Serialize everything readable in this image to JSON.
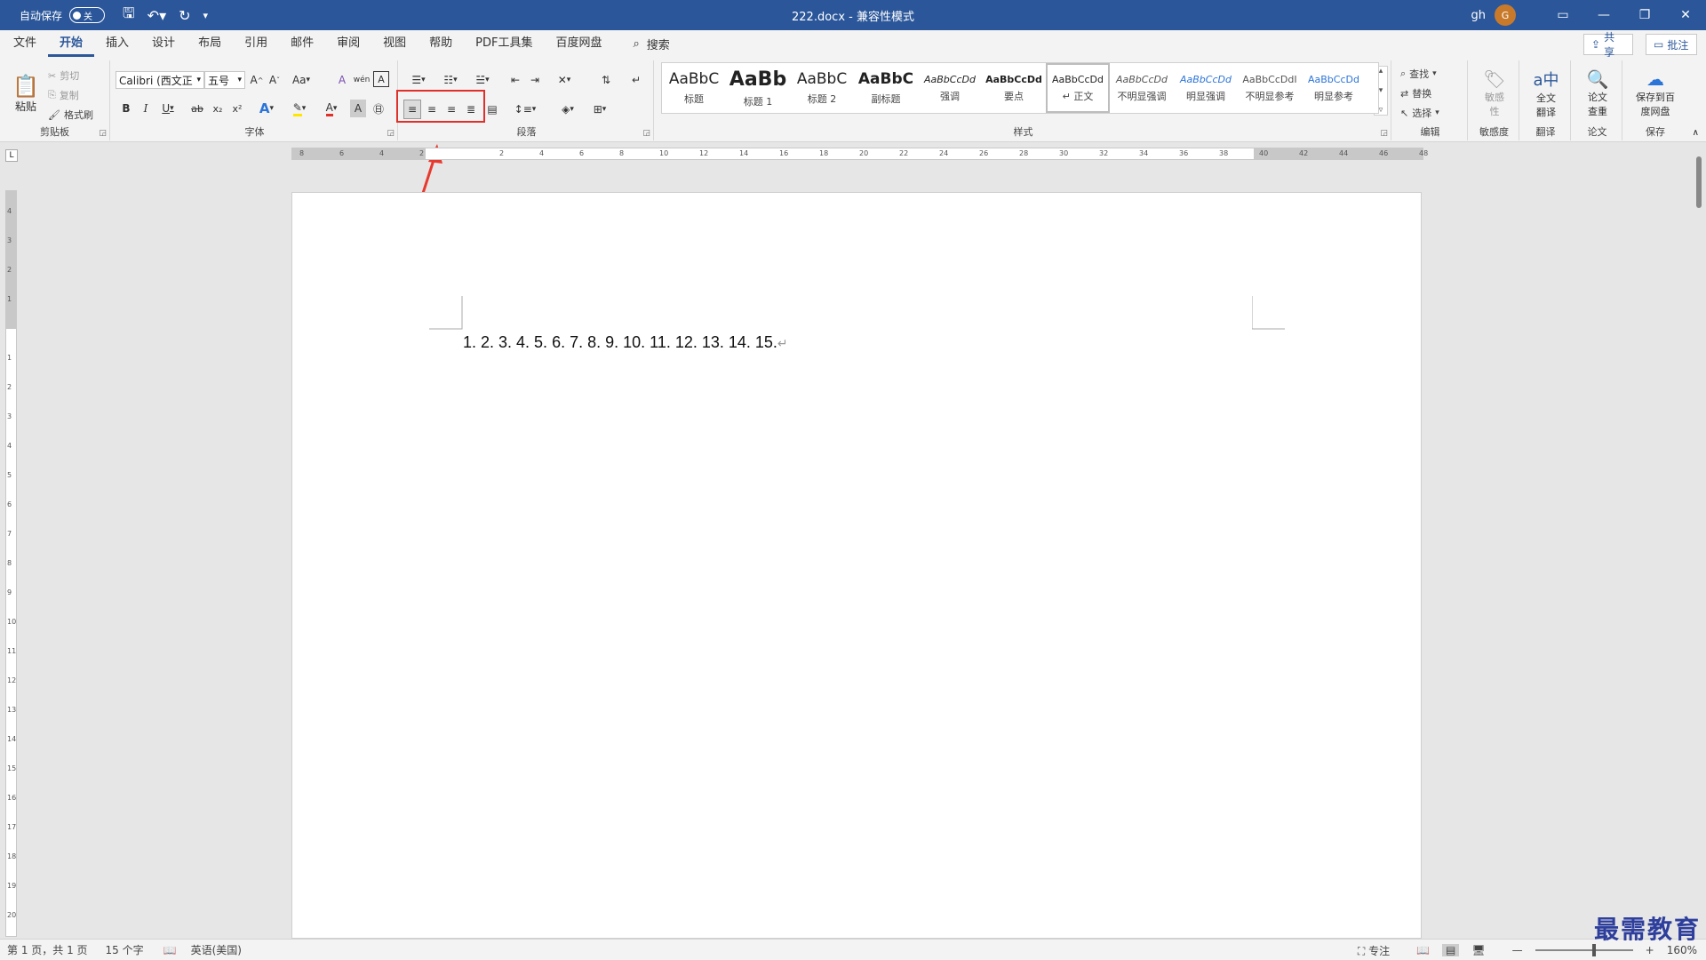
{
  "titlebar": {
    "autosave_label": "自动保存",
    "autosave_state": "关",
    "document_title": "222.docx  -  兼容性模式",
    "user_name": "gh",
    "user_initial": "G"
  },
  "menu": {
    "tabs": [
      "文件",
      "开始",
      "插入",
      "设计",
      "布局",
      "引用",
      "邮件",
      "审阅",
      "视图",
      "帮助",
      "PDF工具集",
      "百度网盘"
    ],
    "active": "开始",
    "search_label": "搜索",
    "share_label": "共享",
    "comment_label": "批注"
  },
  "ribbon": {
    "clipboard": {
      "paste": "粘贴",
      "cut": "剪切",
      "copy": "复制",
      "format_painter": "格式刷",
      "label": "剪贴板"
    },
    "font": {
      "name": "Calibri (西文正",
      "size": "五号",
      "label": "字体",
      "bold": "B",
      "italic": "I",
      "underline": "U",
      "strike": "ab",
      "subscript": "x₂",
      "superscript": "x²",
      "change_case": "Aa",
      "clear": "A",
      "text_effects": "A",
      "wen": "wén"
    },
    "paragraph": {
      "label": "段落"
    },
    "styles": {
      "label": "样式",
      "items": [
        {
          "sample": "AaBbC",
          "name": "标题"
        },
        {
          "sample": "AaBb",
          "name": "标题 1"
        },
        {
          "sample": "AaBbC",
          "name": "标题 2"
        },
        {
          "sample": "AaBbC",
          "name": "副标题"
        },
        {
          "sample": "AaBbCcDd",
          "name": "强调"
        },
        {
          "sample": "AaBbCcDd",
          "name": "要点"
        },
        {
          "sample": "AaBbCcDd",
          "name": "↵ 正文"
        },
        {
          "sample": "AaBbCcDd",
          "name": "不明显强调"
        },
        {
          "sample": "AaBbCcDd",
          "name": "明显强调"
        },
        {
          "sample": "AaBbCcDdI",
          "name": "不明显参考"
        },
        {
          "sample": "AaBbCcDd",
          "name": "明显参考"
        }
      ]
    },
    "editing": {
      "find": "查找",
      "replace": "替换",
      "select": "选择",
      "label": "编辑"
    },
    "sensitivity": {
      "btn": "敏感性",
      "label": "敏感度"
    },
    "translate": {
      "btn": "全文翻译",
      "label": "翻译"
    },
    "paper": {
      "btn": "论文查重",
      "label": "论文"
    },
    "save": {
      "btn": "保存到百度网盘",
      "label": "保存"
    }
  },
  "ruler": {
    "top_marks": [
      "8",
      "6",
      "4",
      "2",
      "",
      "2",
      "4",
      "6",
      "8",
      "10",
      "12",
      "14",
      "16",
      "18",
      "20",
      "22",
      "24",
      "26",
      "28",
      "30",
      "32",
      "34",
      "36",
      "38",
      "40",
      "42",
      "44",
      "46",
      "48"
    ],
    "left_marks": [
      "4",
      "3",
      "2",
      "1",
      "",
      "1",
      "2",
      "3",
      "4",
      "5",
      "6",
      "7",
      "8",
      "9",
      "10",
      "11",
      "12",
      "13",
      "14",
      "15",
      "16",
      "17",
      "18",
      "19",
      "20"
    ]
  },
  "document": {
    "text": "1. 2. 3. 4. 5. 6. 7. 8. 9. 10. 11. 12. 13. 14. 15.",
    "para_mark": "↵"
  },
  "statusbar": {
    "page": "第 1 页，共 1 页",
    "words": "15 个字",
    "language": "英语(美国)",
    "focus": "专注",
    "zoom": "160%"
  },
  "watermark": "最需教育",
  "colors": {
    "accent": "#2b579a",
    "highlight_box": "#e0302a",
    "arrow": "#e8392e"
  }
}
